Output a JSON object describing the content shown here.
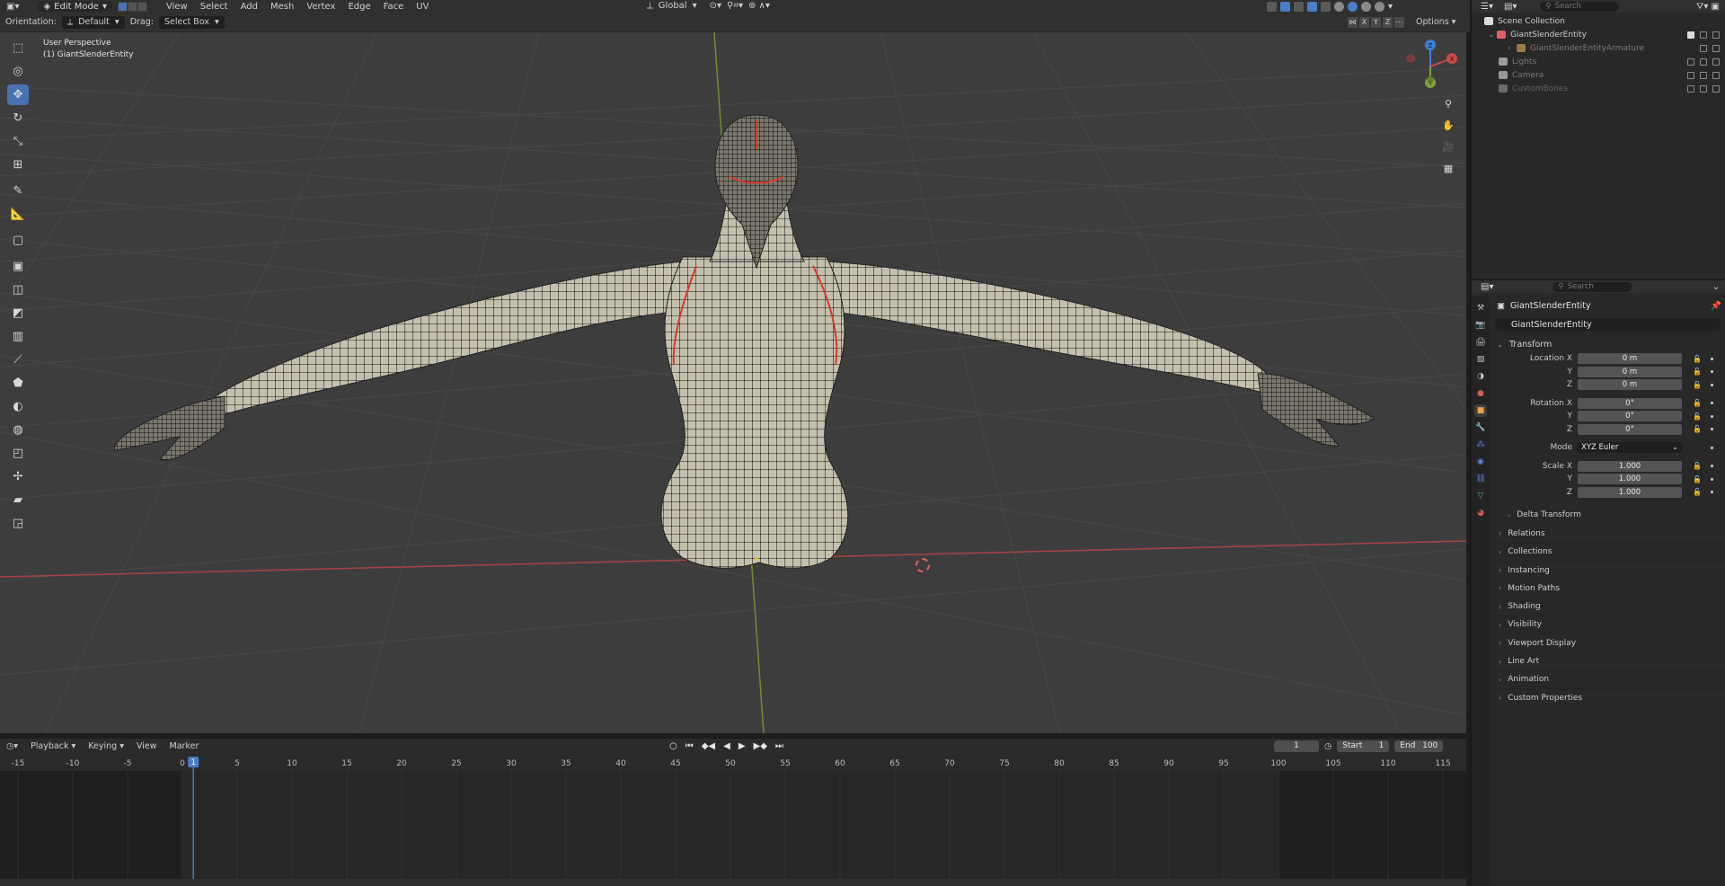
{
  "header": {
    "mode": "Edit Mode",
    "menus": [
      "View",
      "Select",
      "Add",
      "Mesh",
      "Vertex",
      "Edge",
      "Face",
      "UV"
    ],
    "transform_orientation": "Global",
    "search_placeholder": "Search"
  },
  "tool_settings": {
    "orientation_label": "Orientation:",
    "orientation_value": "Default",
    "drag_label": "Drag:",
    "drag_value": "Select Box",
    "axes": [
      "X",
      "Y",
      "Z"
    ],
    "options_label": "Options"
  },
  "viewport": {
    "view_name": "User Perspective",
    "object_label": "(1) GiantSlenderEntity",
    "gizmo": {
      "z": "Z",
      "x": "X",
      "y": "Y"
    }
  },
  "timeline": {
    "menus": [
      "Playback",
      "Keying",
      "View",
      "Marker"
    ],
    "current_frame": "1",
    "start_label": "Start",
    "start_value": "1",
    "end_label": "End",
    "end_value": "100",
    "ruler_ticks": [
      "-15",
      "-10",
      "-5",
      "0",
      "5",
      "10",
      "15",
      "20",
      "25",
      "30",
      "35",
      "40",
      "45",
      "50",
      "55",
      "60",
      "65",
      "70",
      "75",
      "80",
      "85",
      "90",
      "95",
      "100",
      "105",
      "110",
      "115"
    ],
    "playhead_label": "1"
  },
  "outliner": {
    "search_placeholder": "Search",
    "items": [
      {
        "label": "Scene Collection"
      },
      {
        "label": "GiantSlenderEntity"
      },
      {
        "label": "GiantSlenderEntityArmature"
      },
      {
        "label": "Lights"
      },
      {
        "label": "Camera"
      },
      {
        "label": "CustomBones"
      }
    ]
  },
  "properties": {
    "search_placeholder": "Search",
    "object_name": "GiantSlenderEntity",
    "object_field": "GiantSlenderEntity",
    "transform": {
      "title": "Transform",
      "location_label": "Location X",
      "location": [
        "0 m",
        "0 m",
        "0 m"
      ],
      "rotation_label": "Rotation X",
      "rotation": [
        "0°",
        "0°",
        "0°"
      ],
      "mode_label": "Mode",
      "mode_value": "XYZ Euler",
      "scale_label": "Scale X",
      "scale": [
        "1.000",
        "1.000",
        "1.000"
      ],
      "axis_y": "Y",
      "axis_z": "Z",
      "delta": "Delta Transform"
    },
    "panels": [
      "Relations",
      "Collections",
      "Instancing",
      "Motion Paths",
      "Shading",
      "Visibility",
      "Viewport Display",
      "Line Art",
      "Animation",
      "Custom Properties"
    ]
  },
  "colors": {
    "accent": "#4772b3",
    "x_axis": "#c94a4a",
    "y_axis": "#7fa33a",
    "z_axis": "#3f7fd6",
    "mesh": "#c4c0ae"
  }
}
